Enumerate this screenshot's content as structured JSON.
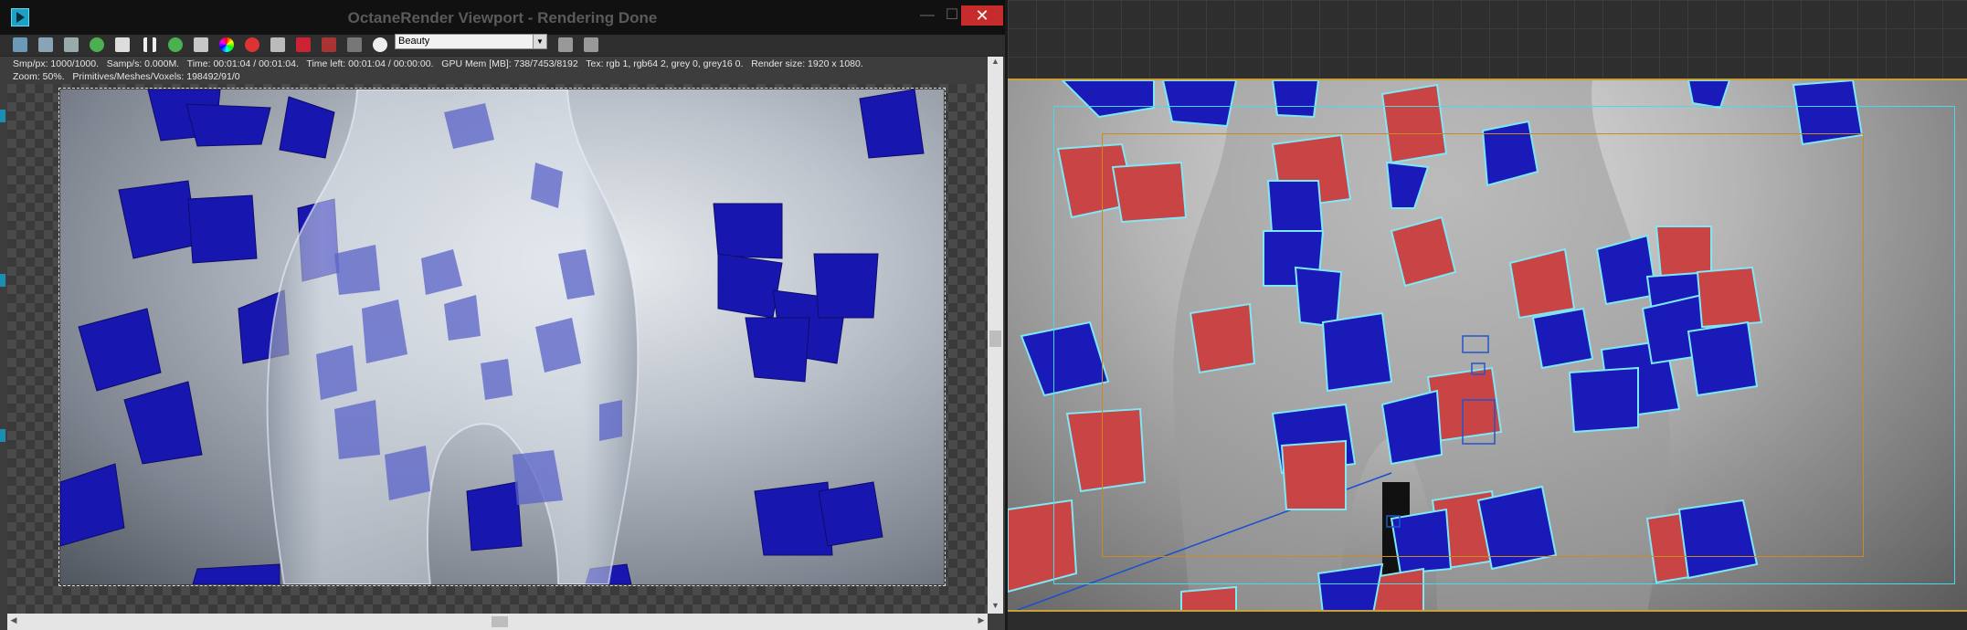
{
  "octane": {
    "window_title": "OctaneRender Viewport - Rendering Done",
    "controls": {
      "minimize": "—",
      "maximize": "☐",
      "close": "✕"
    },
    "render_pass": "Beauty",
    "stats": {
      "line1": "Smp/px: 1000/1000.   Samp/s: 0.000M.   Time: 00:01:04 / 00:01:04.   Time left: 00:01:04 / 00:00:00.   GPU Mem [MB]: 738/7453/8192   Tex: rgb 1, rgb64 2, grey 0, grey16 0.   Render size: 1920 x 1080.",
      "line2": "Zoom: 50%.   Primitives/Meshes/Voxels: 198492/91/0"
    },
    "toolbar_icons": [
      "save-image-icon",
      "save-all-icon",
      "zoom-icon",
      "restart-render-icon",
      "lock-icon",
      "pause-icon",
      "resume-icon",
      "region-render-icon",
      "color-picker-icon",
      "material-picker-icon",
      "display-settings-icon",
      "render-settings-icon",
      "gpu-usage-icon",
      "camera-icon",
      "settings-gear-icon",
      "view-icon-a",
      "view-icon-b"
    ]
  },
  "max_viewport": {
    "label": "3ds Max camera viewport"
  },
  "colors": {
    "title_bar": "#111111",
    "close_button": "#c72c2c",
    "cube_blue": "#1a1ab8",
    "cube_red": "#c94444",
    "selection_outline": "#7fe8f5",
    "safe_frame_gold": "#c7a23a",
    "safe_frame_cyan": "#4ad9e6",
    "safe_frame_orange": "#c98a22"
  }
}
